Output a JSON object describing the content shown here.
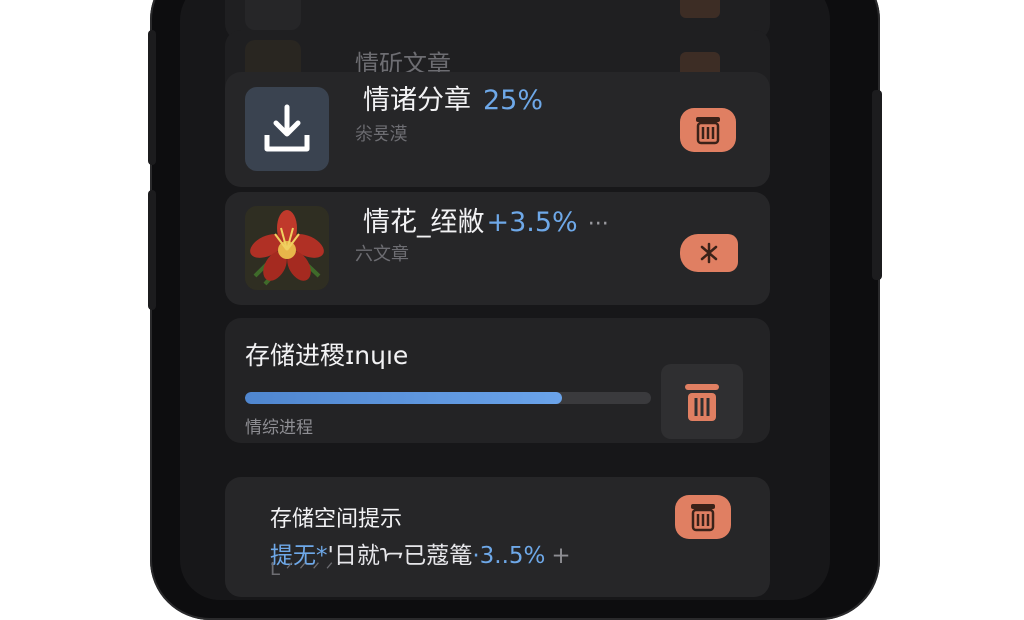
{
  "ghost_rows": [
    {
      "title": ""
    },
    {
      "title": "情斫文章"
    }
  ],
  "items": [
    {
      "title": "情诸分章",
      "percent": "25%",
      "subtitle": "尜룟漠",
      "thumb_icon": "download-icon",
      "action_icon": "trash-icon"
    },
    {
      "title": "情花_绖敝",
      "percent": "+3.5%",
      "more": "···",
      "subtitle": "六文章",
      "thumb_icon": "flower-icon",
      "action_icon": "tag-icon"
    }
  ],
  "storage": {
    "title": "存储进稷ɪnɥıe",
    "progress": 0.78,
    "subtitle": "情综进程",
    "action_icon": "trash-icon"
  },
  "tip": {
    "title": "存储空间提示",
    "prefix": "提无*",
    "middle": "'日就ᢇ已蔻篭",
    "suffix": "·3..5%",
    "trail": "+",
    "bottom": "ᒪ ᐟ ᐟ ᐟ ᐟ",
    "action_icon": "trash-icon"
  },
  "colors": {
    "accent_blue": "#6ea8e8",
    "danger": "#e07f62",
    "card": "#262628",
    "bg": "#171719"
  }
}
